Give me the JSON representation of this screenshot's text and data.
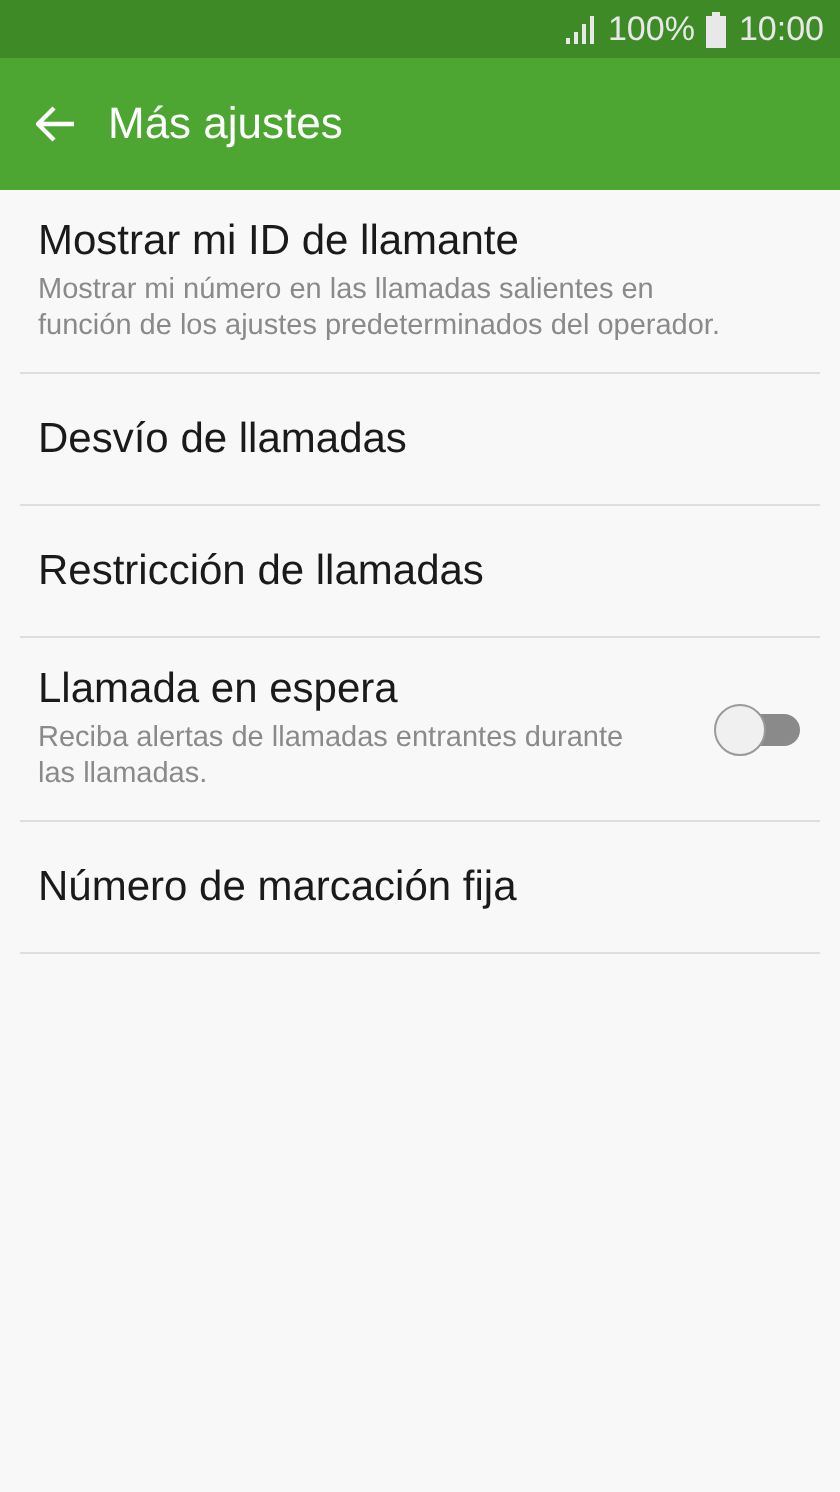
{
  "status_bar": {
    "battery": "100%",
    "time": "10:00"
  },
  "app_bar": {
    "title": "Más ajustes"
  },
  "settings": [
    {
      "kind": "text",
      "title": "Mostrar mi ID de llamante",
      "summary": "Mostrar mi número en las llamadas salientes en función de los ajustes predeterminados del operador."
    },
    {
      "kind": "text",
      "title": "Desvío de llamadas"
    },
    {
      "kind": "text",
      "title": "Restricción de llamadas"
    },
    {
      "kind": "switch",
      "title": "Llamada en espera",
      "summary": "Reciba alertas de llamadas entrantes durante las llamadas.",
      "on": false
    },
    {
      "kind": "text",
      "title": "Número de marcación fija"
    }
  ]
}
